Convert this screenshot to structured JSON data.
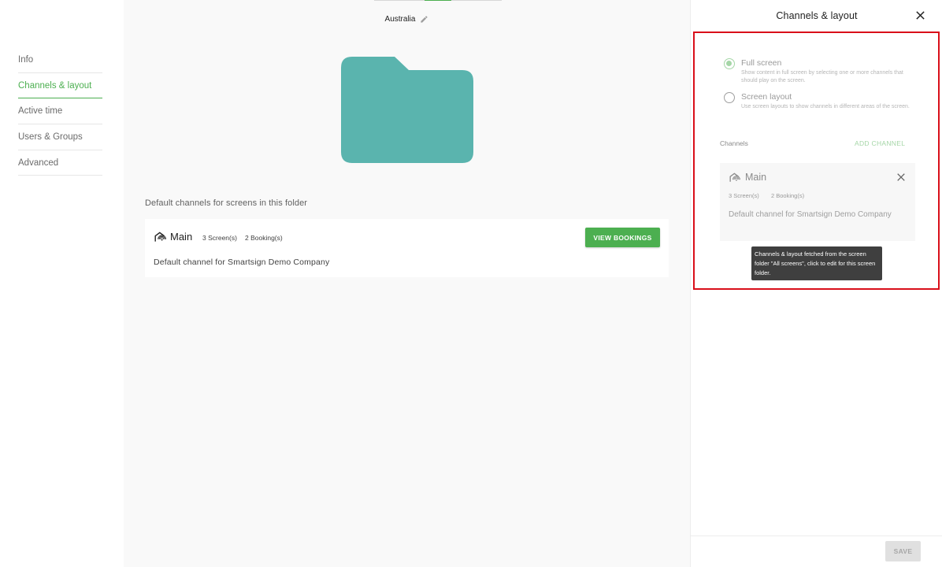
{
  "left_nav": {
    "items": [
      {
        "label": "Info",
        "active": false
      },
      {
        "label": "Channels & layout",
        "active": true
      },
      {
        "label": "Active time",
        "active": false
      },
      {
        "label": "Users & Groups",
        "active": false
      },
      {
        "label": "Advanced",
        "active": false
      }
    ]
  },
  "main": {
    "folder_name": "Australia",
    "folder_color": "#5ab4ae",
    "section_label": "Default channels for screens in this folder",
    "channel": {
      "name": "Main",
      "screens": "3 Screen(s)",
      "bookings": "2 Booking(s)",
      "description": "Default channel for Smartsign Demo Company",
      "view_button": "VIEW BOOKINGS"
    }
  },
  "panel": {
    "title": "Channels & layout",
    "options": {
      "full_screen": {
        "label": "Full screen",
        "description": "Show content in full screen by selecting one or more channels that should play on the screen.",
        "checked": true
      },
      "screen_layout": {
        "label": "Screen layout",
        "description": "Use screen layouts to show channels in different areas of the screen.",
        "checked": false
      }
    },
    "channels_label": "Channels",
    "add_channel": "ADD CHANNEL",
    "channel": {
      "name": "Main",
      "screens": "3 Screen(s)",
      "bookings": "2 Booking(s)",
      "description": "Default channel for Smartsign Demo Company"
    },
    "tooltip": "Channels & layout fetched from the screen folder \"All screens\", click to edit for this screen folder.",
    "save_button": "SAVE"
  },
  "colors": {
    "accent": "#4caf50",
    "accent_disabled": "#a5d6a7",
    "highlight": "#d90f1a"
  }
}
